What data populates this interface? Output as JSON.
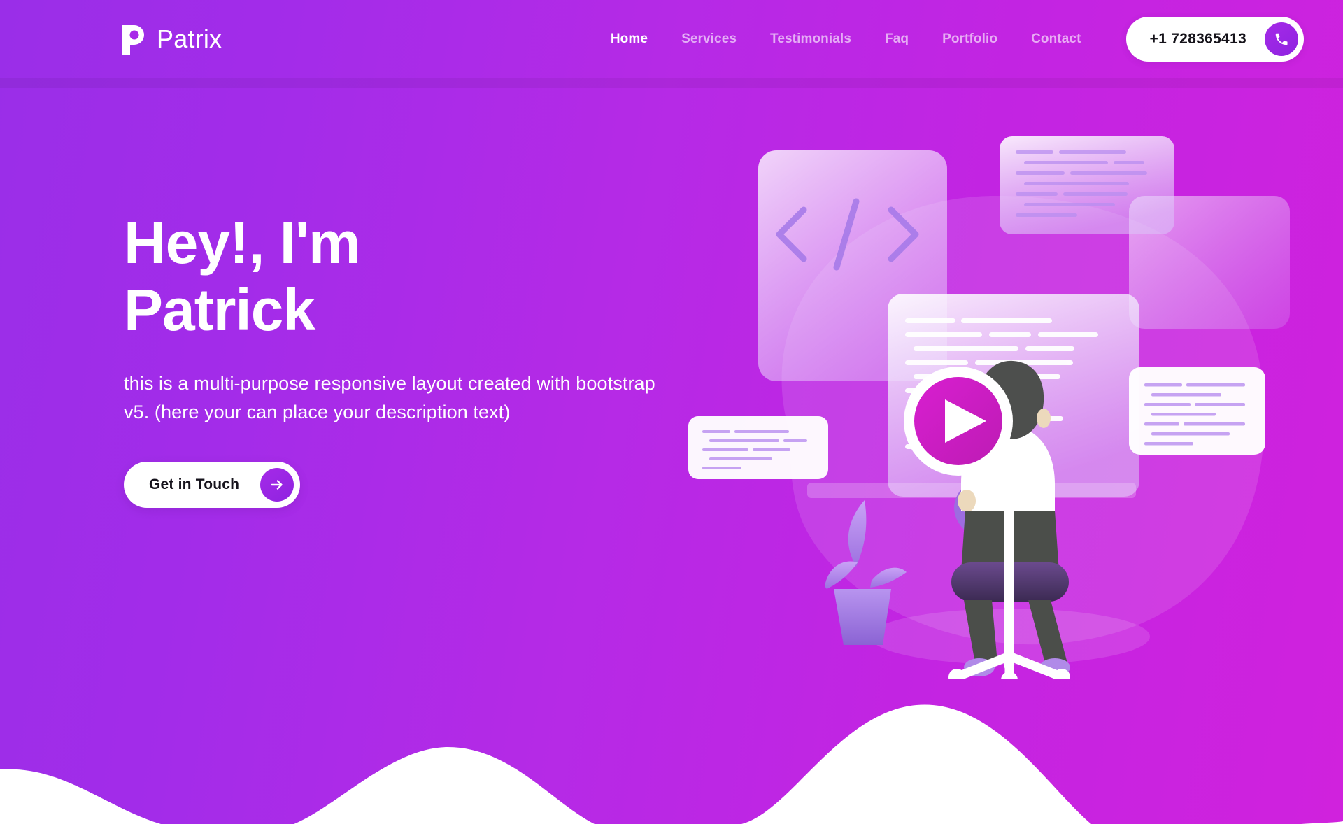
{
  "brand": {
    "name": "Patrix",
    "logo_icon": "patrix-p-logo-icon"
  },
  "nav": {
    "items": [
      {
        "label": "Home",
        "active": true
      },
      {
        "label": "Services",
        "active": false
      },
      {
        "label": "Testimonials",
        "active": false
      },
      {
        "label": "Faq",
        "active": false
      },
      {
        "label": "Portfolio",
        "active": false
      },
      {
        "label": "Contact",
        "active": false
      }
    ],
    "phone": {
      "number": "+1 728365413",
      "icon": "phone-icon"
    }
  },
  "hero": {
    "title_line1": "Hey!, I'm",
    "title_line2": "Patrick",
    "description": "this is a multi-purpose responsive layout created with bootstrap v5. (here your can place your description text)",
    "cta": {
      "label": "Get in Touch",
      "icon": "arrow-right-icon"
    },
    "illustration": {
      "name": "developer-at-desk-illustration",
      "elements": [
        "code-tag-card",
        "code-snippet-cards",
        "play-button-badge",
        "person-on-office-chair",
        "potted-plant"
      ]
    }
  },
  "colors": {
    "gradient_start": "#9A2EE8",
    "gradient_end": "#D022DD",
    "accent_purple": "#A52AE8",
    "play_magenta": "#CC22C0",
    "surface_white": "#FFFFFF",
    "text_dark": "#16131C"
  }
}
